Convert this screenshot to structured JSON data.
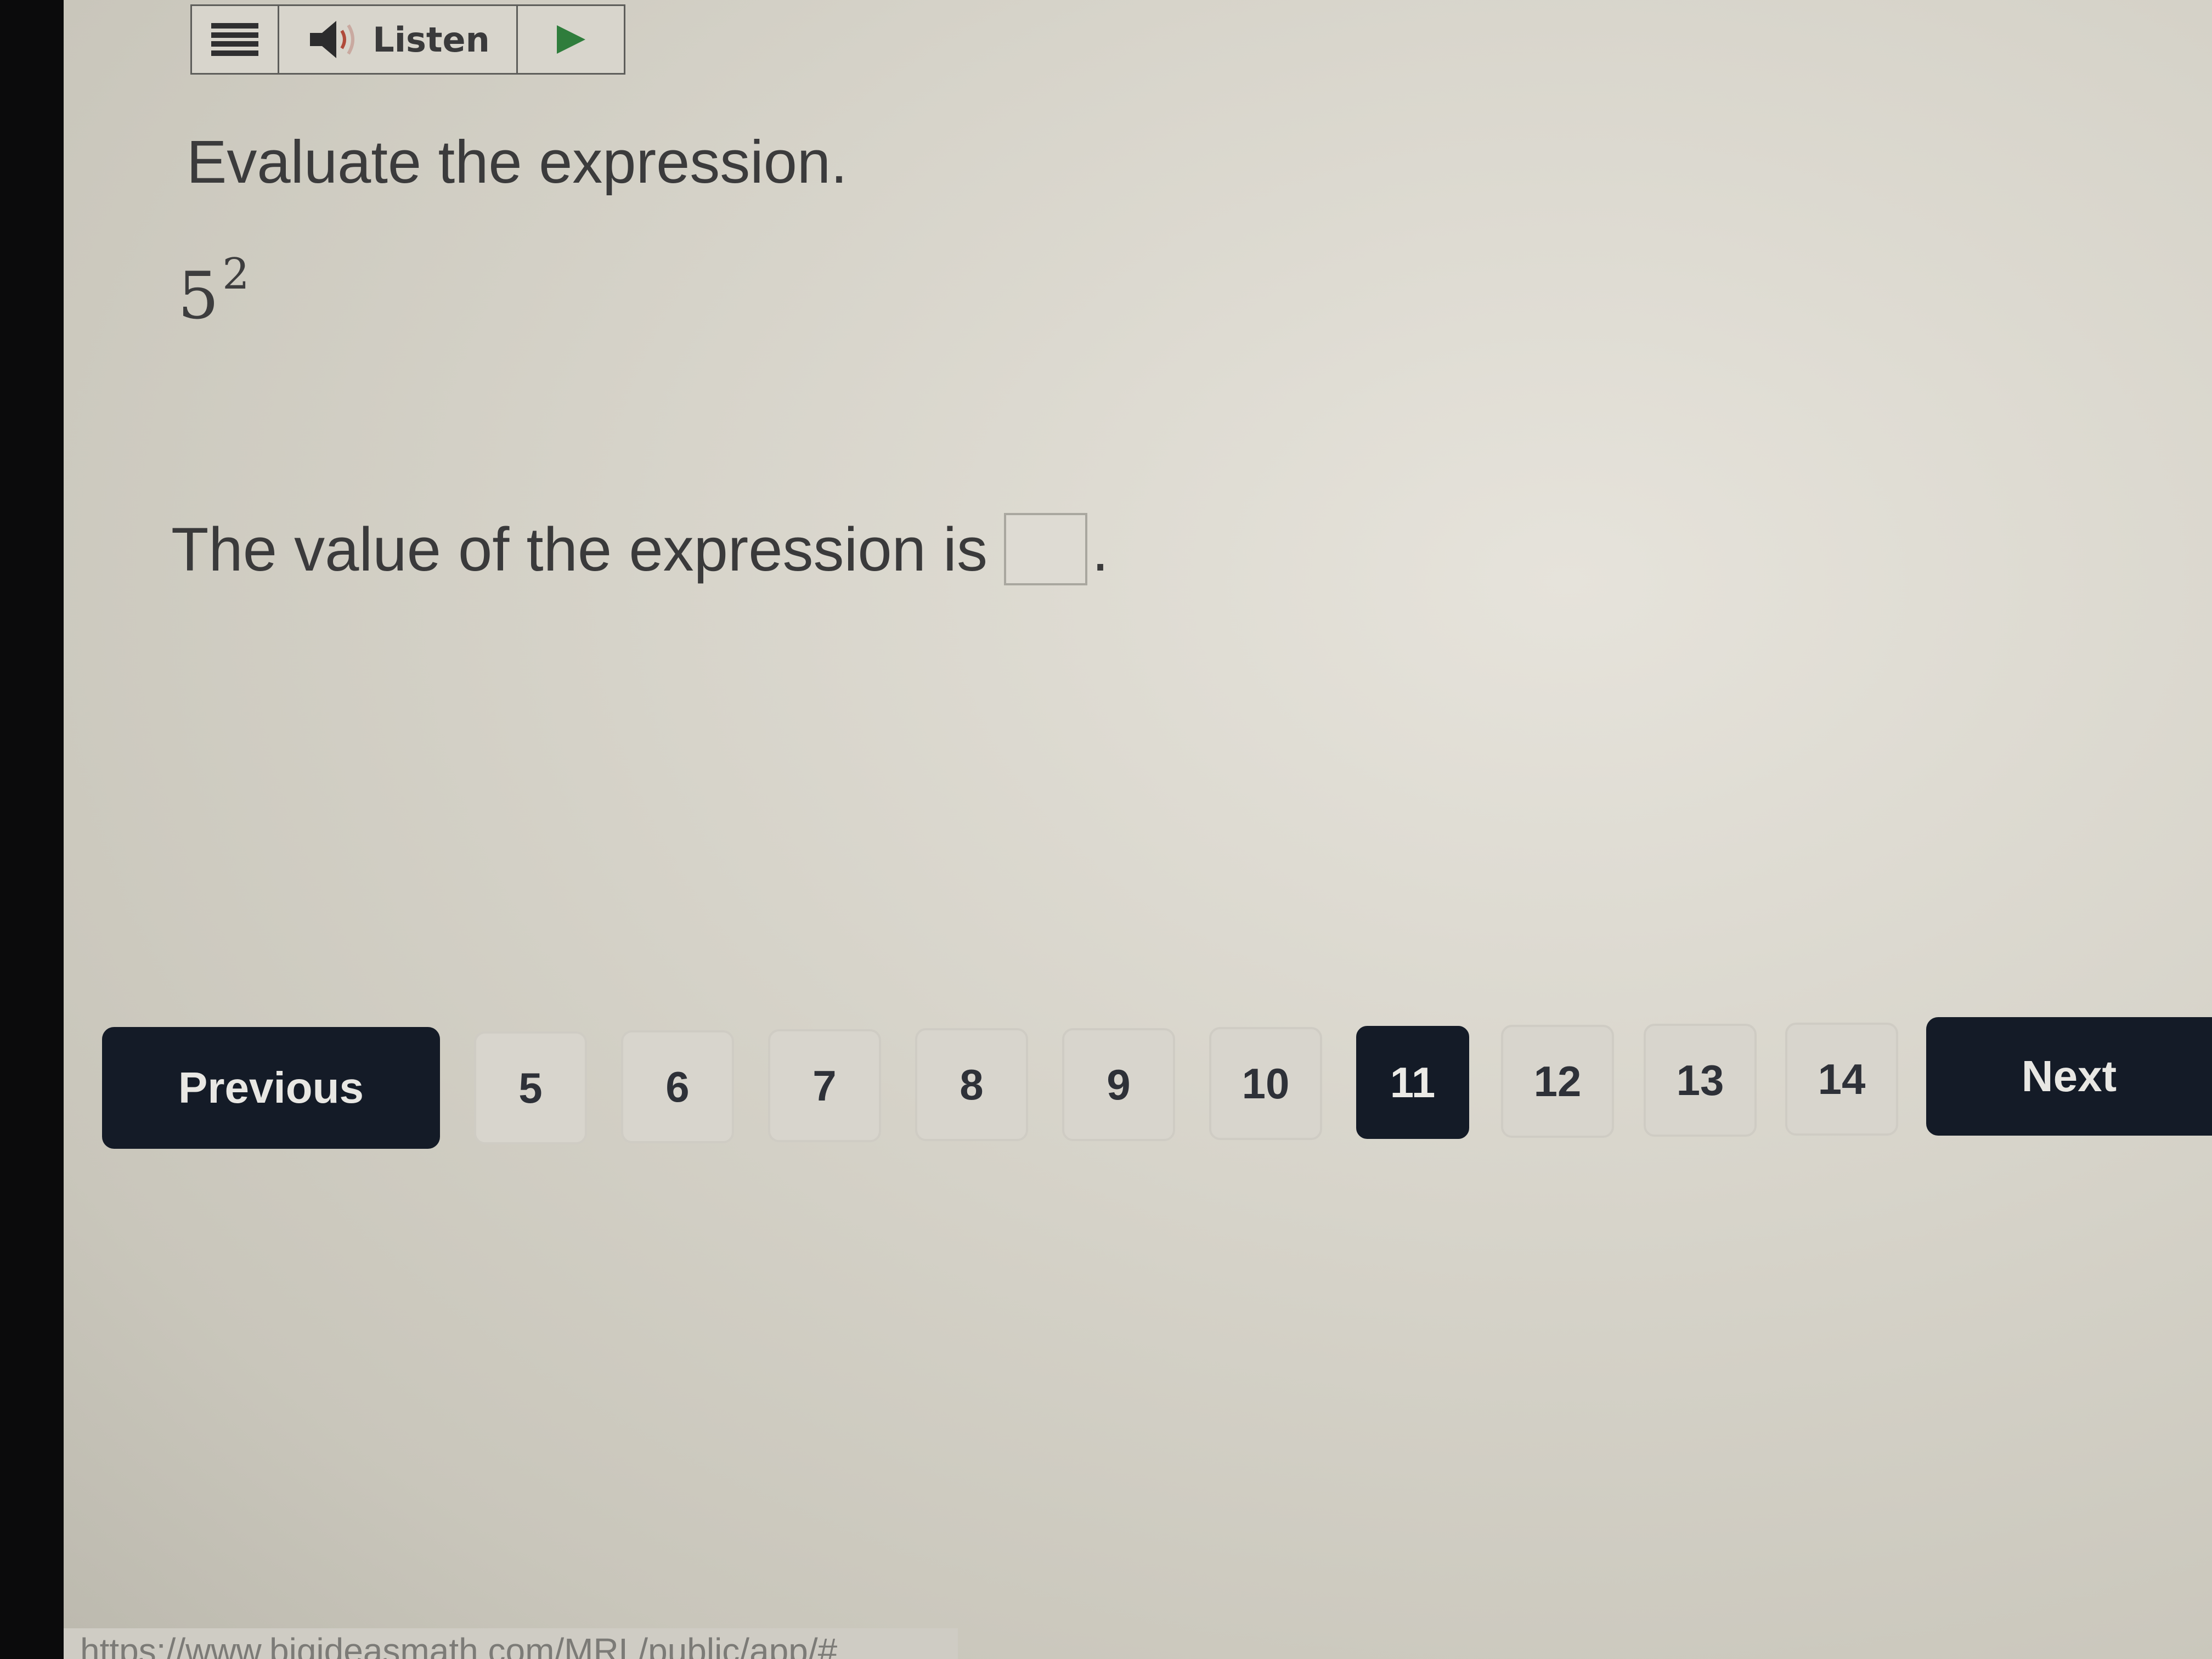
{
  "toolbar": {
    "menu_icon": "hamburger-menu-icon",
    "speaker_icon": "speaker-icon",
    "listen_label": "Listen",
    "play_icon": "play-triangle-icon",
    "play_color": "#2f7d3c"
  },
  "question": {
    "instruction": "Evaluate the expression.",
    "base": "5",
    "exponent": "2",
    "answer_prefix": "The value of the expression is",
    "answer_value": "",
    "answer_suffix": "."
  },
  "pagination": {
    "previous_label": "Previous",
    "next_label": "Next",
    "pages": [
      "5",
      "6",
      "7",
      "8",
      "9",
      "10",
      "11",
      "12",
      "13",
      "14"
    ],
    "current_page": "11",
    "accent_color": "#141b27"
  },
  "status_bar": {
    "url": "https://www.bigideasmath.com/MRL/public/app/#"
  }
}
